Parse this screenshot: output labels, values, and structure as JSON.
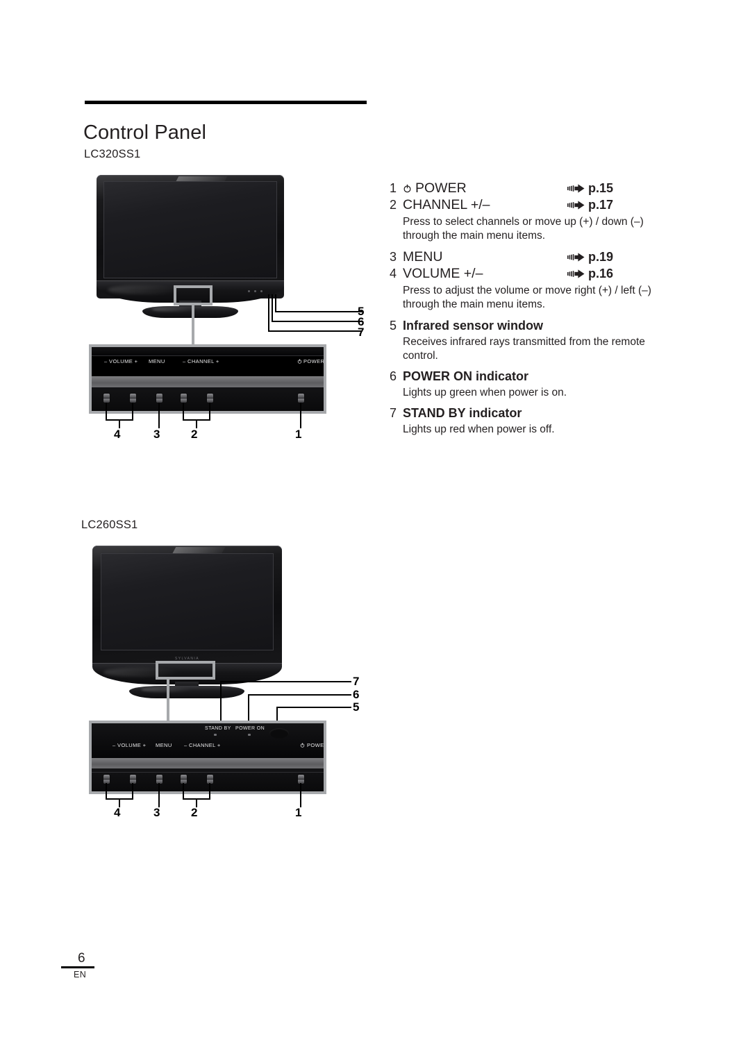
{
  "document": {
    "title": "Control Panel",
    "footer": {
      "page_number": "6",
      "language": "EN"
    }
  },
  "figures": [
    {
      "model": "LC320SS1",
      "brand_logo": "",
      "panel_labels": {
        "volume": "– VOLUME +",
        "menu": "MENU",
        "channel": "– CHANNEL +",
        "power": "POWER"
      },
      "indicator_labels": {
        "standby": "",
        "power_on": ""
      },
      "button_callouts": [
        "4",
        "3",
        "2",
        "1"
      ],
      "tv_callouts": [
        "5",
        "6",
        "7"
      ]
    },
    {
      "model": "LC260SS1",
      "brand_logo": "SYLVANIA",
      "panel_labels": {
        "volume": "– VOLUME +",
        "menu": "MENU",
        "channel": "– CHANNEL +",
        "power": "POWER"
      },
      "indicator_labels": {
        "standby": "STAND BY",
        "power_on": "POWER ON"
      },
      "button_callouts": [
        "4",
        "3",
        "2",
        "1"
      ],
      "tv_callouts": [
        "7",
        "6",
        "5"
      ]
    }
  ],
  "spec_list": [
    {
      "number": "1",
      "title": "POWER",
      "has_power_icon": true,
      "page_ref": "p.15",
      "description": ""
    },
    {
      "number": "2",
      "title": "CHANNEL +/–",
      "has_power_icon": false,
      "page_ref": "p.17",
      "description": "Press to select channels or move up (+) / down (–) through the main menu items."
    },
    {
      "number": "3",
      "title": "MENU",
      "has_power_icon": false,
      "page_ref": "p.19",
      "description": ""
    },
    {
      "number": "4",
      "title": "VOLUME +/–",
      "has_power_icon": false,
      "page_ref": "p.16",
      "description": "Press to adjust the volume or move right (+) / left (–) through the main menu items."
    },
    {
      "number": "5",
      "title": "Infrared sensor window",
      "has_power_icon": false,
      "page_ref": "",
      "description": "Receives infrared rays transmitted from the remote control."
    },
    {
      "number": "6",
      "title": "POWER ON indicator",
      "has_power_icon": false,
      "page_ref": "",
      "description": "Lights up green when power is on."
    },
    {
      "number": "7",
      "title": "STAND BY indicator",
      "has_power_icon": false,
      "page_ref": "",
      "description": "Lights up red when power is off."
    }
  ]
}
